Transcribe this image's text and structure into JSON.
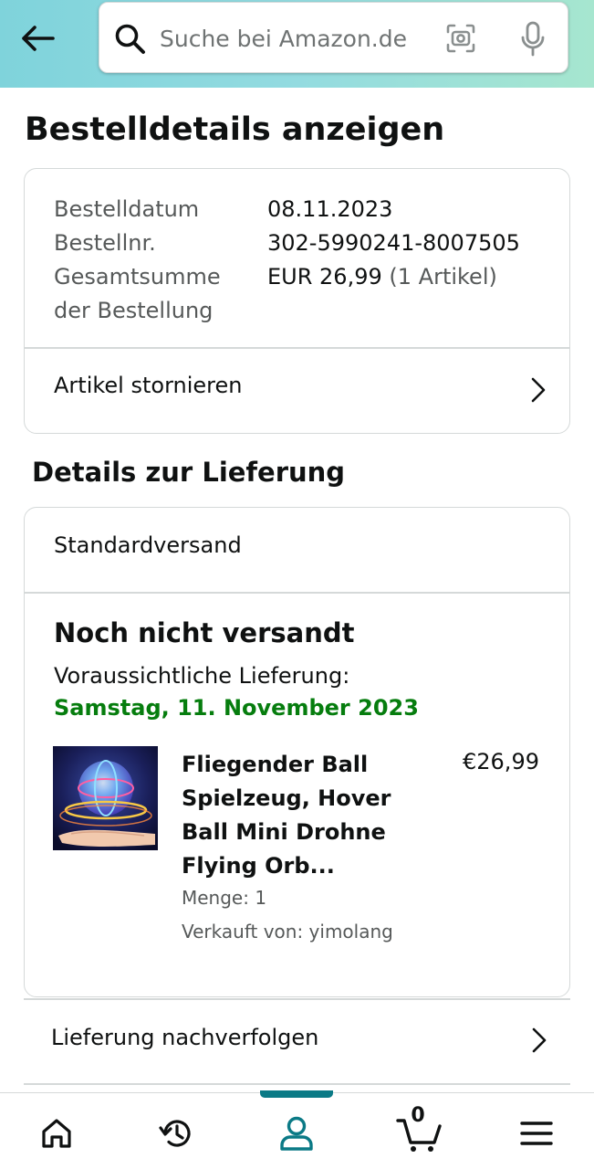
{
  "header": {
    "search_placeholder": "Suche bei Amazon.de"
  },
  "page": {
    "title": "Bestelldetails anzeigen"
  },
  "order_summary": {
    "date_label": "Bestelldatum",
    "date_value": "08.11.2023",
    "number_label": "Bestellnr.",
    "number_value": "302-5990241-8007505",
    "total_label_line1": "Gesamtsumme",
    "total_label_line2": "der Bestellung",
    "total_value": "EUR 26,99",
    "total_items": "(1 Artikel)",
    "cancel_label": "Artikel stornieren"
  },
  "delivery": {
    "section_title": "Details zur Lieferung",
    "shipping_method": "Standardversand",
    "status": "Noch nicht versandt",
    "eta_label": "Voraussichtliche Lieferung:",
    "eta_date": "Samstag, 11. November 2023",
    "product": {
      "title": "Fliegender Ball Spielzeug, Hover Ball Mini Drohne Flying Orb...",
      "price": "€26,99",
      "quantity": "Menge: 1",
      "seller": "Verkauft von: yimolang"
    },
    "track_label": "Lieferung nachverfolgen"
  },
  "bottom_nav": {
    "cart_count": "0",
    "active": "account",
    "accent": "#0b7a86"
  },
  "icons": [
    "back-arrow-icon",
    "search-icon",
    "camera-icon",
    "mic-icon",
    "chevron-right-icon",
    "home-icon",
    "history-icon",
    "account-icon",
    "cart-icon",
    "menu-icon"
  ]
}
